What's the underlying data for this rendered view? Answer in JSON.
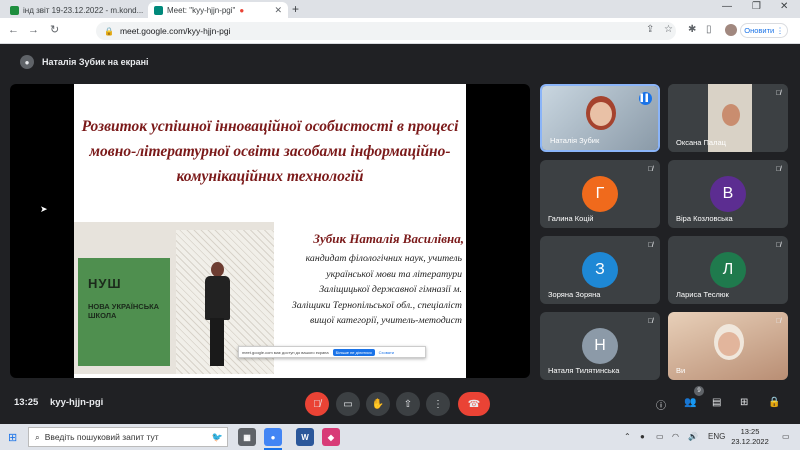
{
  "browser": {
    "tabs": [
      {
        "title": "інд звіт 19-23.12.2022 - m.kond...",
        "active": false
      },
      {
        "title": "Meet: \"kyy-hjjn-pgi\"",
        "active": true
      }
    ],
    "address": "meet.google.com/kyy-hjjn-pgi",
    "update_label": "Оновити"
  },
  "presenter_label": "Наталія Зубик на екрані",
  "slide": {
    "title": "Розвиток успішної інноваційної особистості в процесі мовно-літературної освіти засобами інформаційно-комунікаційних технологій",
    "author": "Зубик Наталія Василівна,",
    "author_desc": "кандидат філологічних наук, учитель української мови та літератури Заліщицької державної гімназії м. Заліщики Тернопільської обл., спеціаліст вищої категорії, учитель-методист",
    "banner_word": "НУШ",
    "banner_sub": "НОВА УКРАЇНСЬКА ШКОЛА",
    "notification": {
      "text": "meet.google.com має доступ до вашого екрана",
      "stop_label": "Більше не ділитися",
      "hide_label": "Сховати"
    }
  },
  "participants": [
    {
      "name": "Наталія Зубик",
      "type": "video",
      "speaking": true
    },
    {
      "name": "Оксана Палац",
      "type": "video",
      "speaking": false
    },
    {
      "name": "Галина Коцій",
      "initial": "Г",
      "color": "#f06a1c",
      "type": "avatar"
    },
    {
      "name": "Віра Козловська",
      "initial": "В",
      "color": "#5c2d91",
      "type": "avatar"
    },
    {
      "name": "Зоряна Зоряна",
      "initial": "З",
      "color": "#1e88d5",
      "type": "avatar"
    },
    {
      "name": "Лариса Теслюк",
      "initial": "Л",
      "color": "#1f7a4d",
      "type": "avatar"
    },
    {
      "name": "Наталя Тилятинська",
      "initial": "Н",
      "color": "#8c9aa8",
      "type": "avatar"
    },
    {
      "name": "Ви",
      "type": "video",
      "speaking": false
    }
  ],
  "meeting": {
    "time": "13:25",
    "code": "kyy-hjjn-pgi",
    "participant_count": "9"
  },
  "taskbar": {
    "search_placeholder": "Введіть пошуковий запит тут",
    "language": "ENG",
    "time": "13:25",
    "date": "23.12.2022"
  }
}
